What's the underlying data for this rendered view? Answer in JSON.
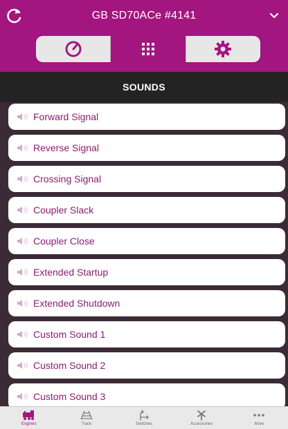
{
  "header": {
    "title": "GB SD70ACe #4141",
    "refresh_icon": "refresh-icon",
    "dropdown_icon": "chevron-down-icon"
  },
  "tabs": [
    {
      "name": "speedometer-icon",
      "active": false
    },
    {
      "name": "keypad-icon",
      "active": true
    },
    {
      "name": "gear-icon",
      "active": false
    }
  ],
  "section": {
    "title": "SOUNDS"
  },
  "sounds": [
    "Forward Signal",
    "Reverse Signal",
    "Crossing Signal",
    "Coupler Slack",
    "Coupler Close",
    "Extended Startup",
    "Extended Shutdown",
    "Custom Sound 1",
    "Custom Sound 2",
    "Custom Sound 3"
  ],
  "bottom_nav": [
    {
      "label": "Engines",
      "icon": "train-icon",
      "active": true
    },
    {
      "label": "Track",
      "icon": "track-icon",
      "active": false
    },
    {
      "label": "Switches",
      "icon": "switch-icon",
      "active": false
    },
    {
      "label": "Accessories",
      "icon": "crossing-icon",
      "active": false
    },
    {
      "label": "More",
      "icon": "more-icon",
      "active": false
    }
  ],
  "colors": {
    "accent": "#a3157f",
    "list_bg": "#3a2b36",
    "section_bg": "#232323",
    "item_text": "#8a1d6f"
  }
}
